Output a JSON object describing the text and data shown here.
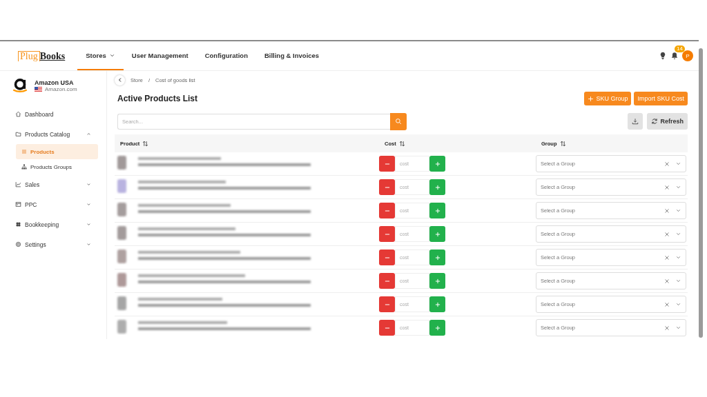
{
  "header": {
    "logo": {
      "first": "Plug",
      "second": "Books"
    },
    "nav": [
      {
        "label": "Stores",
        "selected": true,
        "dropdown": true
      },
      {
        "label": "User Management",
        "selected": false,
        "dropdown": false
      },
      {
        "label": "Configuration",
        "selected": false,
        "dropdown": false
      },
      {
        "label": "Billing & Invoices",
        "selected": false,
        "dropdown": false
      }
    ],
    "notifications": {
      "count": "14"
    },
    "avatar": "P"
  },
  "sidebar": {
    "store": {
      "name": "Amazon USA",
      "domain": "Amazon.com"
    },
    "items": [
      {
        "label": "Dashboard",
        "kind": "link"
      },
      {
        "label": "Products Catalog",
        "kind": "group",
        "expanded": true,
        "children": [
          {
            "label": "Products",
            "selected": true
          },
          {
            "label": "Products Groups",
            "selected": false
          }
        ]
      },
      {
        "label": "Sales",
        "kind": "group",
        "expanded": false
      },
      {
        "label": "PPC",
        "kind": "group",
        "expanded": false
      },
      {
        "label": "Bookkeeping",
        "kind": "group",
        "expanded": false
      },
      {
        "label": "Settings",
        "kind": "group",
        "expanded": false
      }
    ]
  },
  "breadcrumb": {
    "items": [
      "Store",
      "Cost of goods list"
    ],
    "separator": "/"
  },
  "title": "Active Products List",
  "actions": [
    {
      "label": "SKU Group",
      "plus": true
    },
    {
      "label": "Import SKU Cost",
      "plus": false
    }
  ],
  "search": {
    "placeholder": "Search..."
  },
  "refresh": "Refresh",
  "table": {
    "columns": [
      "Product",
      "Cost",
      "Group"
    ],
    "rows": [
      {
        "cost": {
          "placeholder": "cost"
        },
        "group": {
          "placeholder": "Select a Group"
        }
      },
      {
        "cost": {
          "placeholder": "cost"
        },
        "group": {
          "placeholder": "Select a Group"
        }
      },
      {
        "cost": {
          "placeholder": "cost"
        },
        "group": {
          "placeholder": "Select a Group"
        }
      },
      {
        "cost": {
          "placeholder": "cost"
        },
        "group": {
          "placeholder": "Select a Group"
        }
      },
      {
        "cost": {
          "placeholder": "cost"
        },
        "group": {
          "placeholder": "Select a Group"
        }
      },
      {
        "cost": {
          "placeholder": "cost"
        },
        "group": {
          "placeholder": "Select a Group"
        }
      },
      {
        "cost": {
          "placeholder": "cost"
        },
        "group": {
          "placeholder": "Select a Group"
        }
      },
      {
        "cost": {
          "placeholder": "cost"
        },
        "group": {
          "placeholder": "Select a Group"
        }
      }
    ]
  }
}
